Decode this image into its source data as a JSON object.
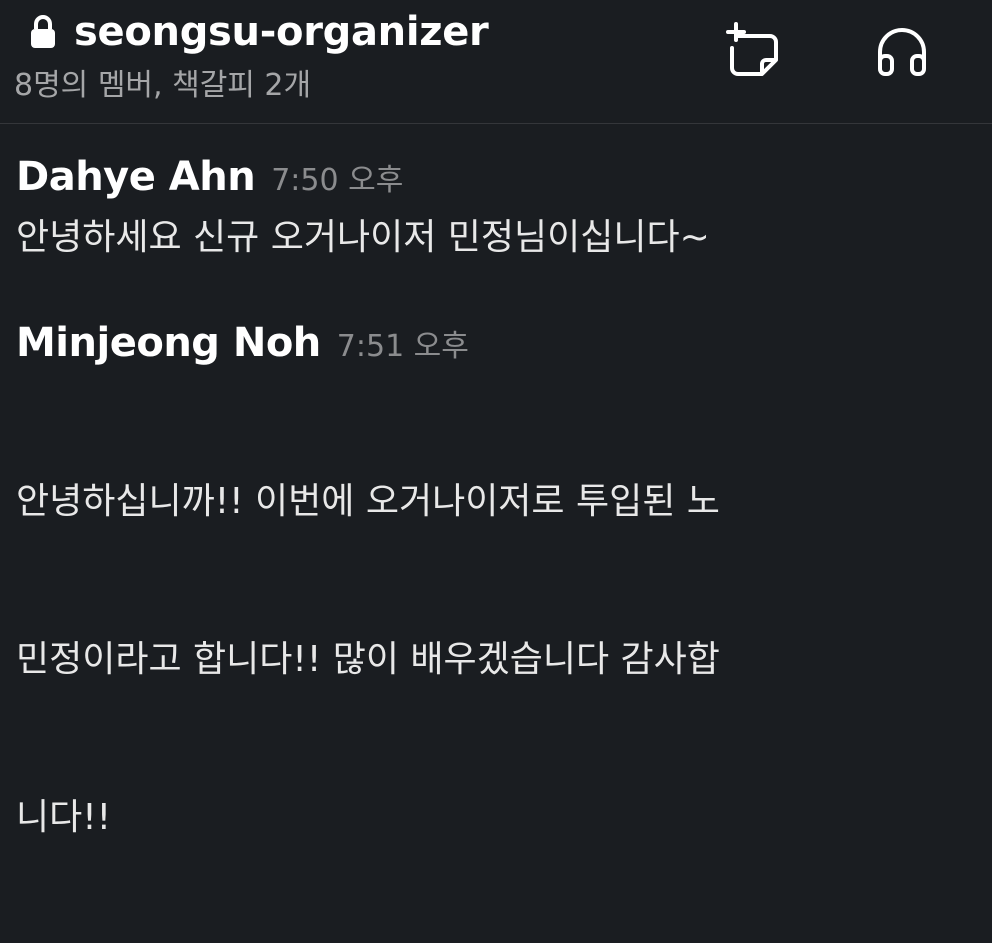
{
  "header": {
    "channel_name": "seongsu-organizer",
    "meta": "8명의 멤버, 책갈피 2개",
    "icons": [
      "lock-icon",
      "add-canvas-icon",
      "headphones-icon"
    ]
  },
  "messages": [
    {
      "sender": "Dahye Ahn",
      "time": "7:50 오후",
      "text": "안녕하세요 신규 오거나이저 민정님이십니다~"
    },
    {
      "sender": "Minjeong Noh",
      "time": "7:51 오후",
      "text_lines": [
        "안녕하십니까!! 이번에 오거나이저로 투입된 노",
        "민정이라고 합니다!! 많이 배우겠습니다 감사합",
        "니다!!"
      ]
    }
  ],
  "colors": {
    "background": "#1a1d21",
    "text_primary": "#ffffff",
    "text_secondary": "#a5a6a8"
  }
}
